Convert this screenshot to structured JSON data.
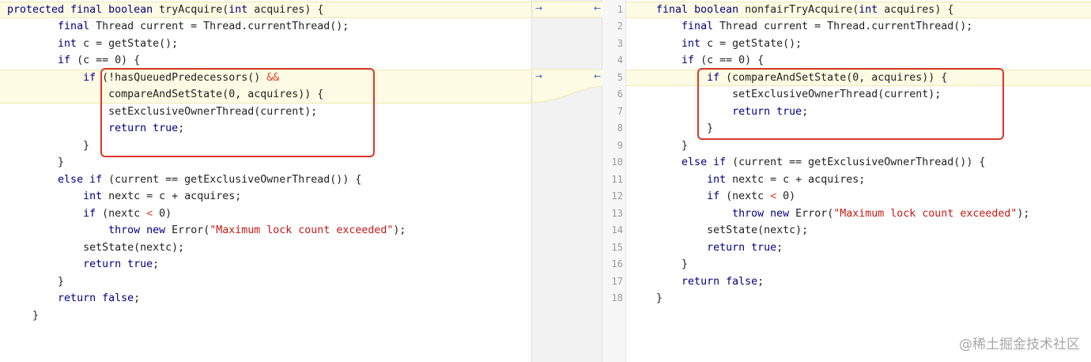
{
  "left_code": [
    "protected final boolean tryAcquire(int acquires) {",
    "        final Thread current = Thread.currentThread();",
    "        int c = getState();",
    "        if (c == 0) {",
    "            if (!hasQueuedPredecessors() &&",
    "                compareAndSetState(0, acquires)) {",
    "                setExclusiveOwnerThread(current);",
    "                return true;",
    "            }",
    "        }",
    "        else if (current == getExclusiveOwnerThread()) {",
    "            int nextc = c + acquires;",
    "            if (nextc < 0)",
    "                throw new Error(\"Maximum lock count exceeded\");",
    "            setState(nextc);",
    "            return true;",
    "        }",
    "        return false;",
    "    }"
  ],
  "right_code": [
    "    final boolean nonfairTryAcquire(int acquires) {",
    "        final Thread current = Thread.currentThread();",
    "        int c = getState();",
    "        if (c == 0) {",
    "            if (compareAndSetState(0, acquires)) {",
    "                setExclusiveOwnerThread(current);",
    "                return true;",
    "            }",
    "        }",
    "        else if (current == getExclusiveOwnerThread()) {",
    "            int nextc = c + acquires;",
    "            if (nextc < 0)",
    "                throw new Error(\"Maximum lock count exceeded\");",
    "            setState(nextc);",
    "            return true;",
    "        }",
    "        return false;",
    "    }"
  ],
  "line_numbers": [
    "1",
    "2",
    "3",
    "4",
    "5",
    "6",
    "7",
    "8",
    "9",
    "10",
    "11",
    "12",
    "13",
    "14",
    "15",
    "16",
    "17",
    "18"
  ],
  "diff_markers": {
    "left_arrow": "→",
    "right_arrow": "←"
  },
  "watermark": "@稀土掘金技术社区"
}
